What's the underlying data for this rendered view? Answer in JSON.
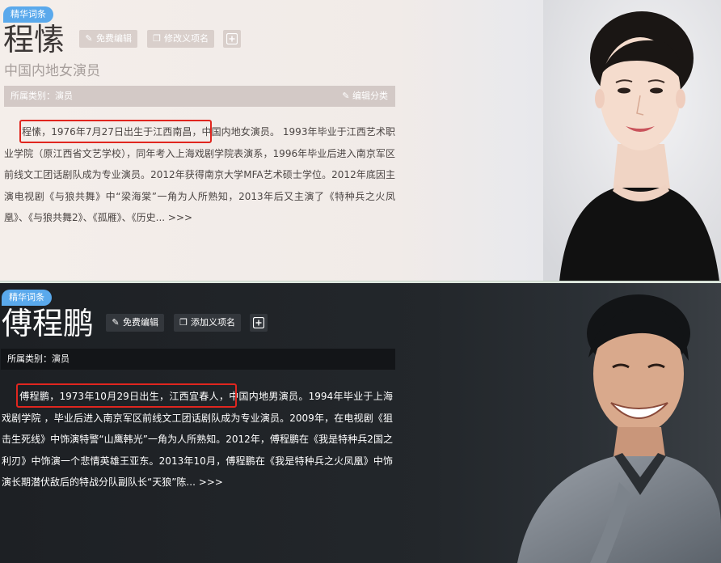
{
  "panels": [
    {
      "badge": "精华词条",
      "name": "程愫",
      "buttons": {
        "edit": "免费编辑",
        "modify": "修改义项名"
      },
      "subtitle": "中国内地女演员",
      "category": "所属类别：演员",
      "edit_category": "编辑分类",
      "summary_highlight": "程愫，1976年7月27日出生于江西南昌，",
      "summary_rest": "中国内地女演员。 1993年毕业于江西艺术职业学院（原江西省文艺学校），同年考入上海戏剧学院表演系，1996年毕业后进入南京军区前线文工团话剧队成为专业演员。2012年获得南京大学MFA艺术硕士学位。2012年底因主演电视剧《与狼共舞》中“梁海棠”一角为人所熟知，2013年后又主演了《特种兵之火凤凰》、《与狼共舞2》、《孤雁》、《历史... >>>"
    },
    {
      "badge": "精华词条",
      "name": "傅程鹏",
      "buttons": {
        "edit": "免费编辑",
        "modify": "添加义项名"
      },
      "category": "所属类别：演员",
      "summary_highlight": "傅程鹏，1973年10月29日出生，江西宜春人，",
      "summary_rest": "中国内地男演员。1994年毕业于上海戏剧学院 ，毕业后进入南京军区前线文工团话剧队成为专业演员。2009年，在电视剧《狙击生死线》中饰演特警“山鹰韩光”一角为人所熟知。2012年，傅程鹏在《我是特种兵2国之利刃》中饰演一个悲情英雄王亚东。2013年10月，傅程鹏在《我是特种兵之火凤凰》中饰演长期潜伏敌后的特战分队副队长“天狼”陈... >>>"
    }
  ],
  "icons": {
    "edit": "pencil-icon",
    "modify": "copy-icon",
    "add": "plus-icon"
  },
  "colors": {
    "badge": "#5aa9ec",
    "highlight_border": "#e0261f"
  }
}
